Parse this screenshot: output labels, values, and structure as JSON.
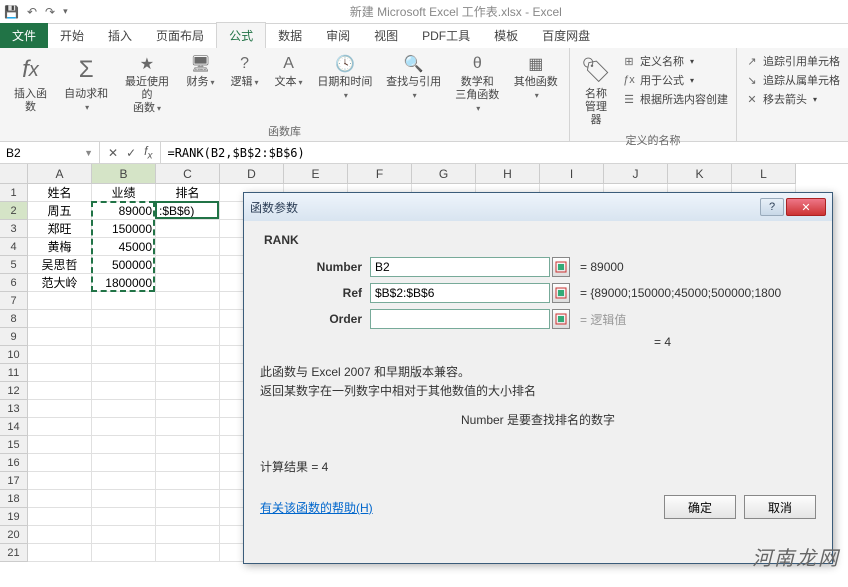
{
  "app": {
    "title": "新建 Microsoft Excel 工作表.xlsx - Excel"
  },
  "tabs": {
    "file": "文件",
    "home": "开始",
    "insert": "插入",
    "layout": "页面布局",
    "formula": "公式",
    "data": "数据",
    "review": "审阅",
    "view": "视图",
    "pdf": "PDF工具",
    "tpl": "模板",
    "baidu": "百度网盘"
  },
  "ribbon": {
    "insertfn": "插入函数",
    "autosum": "自动求和",
    "recent": "最近使用的\n函数",
    "financial": "财务",
    "logical": "逻辑",
    "text": "文本",
    "datetime": "日期和时间",
    "lookup": "查找与引用",
    "math": "数学和\n三角函数",
    "more": "其他函数",
    "fnlib": "函数库",
    "namemgr": "名称\n管理器",
    "defname": "定义名称",
    "usefml": "用于公式",
    "fromsel": "根据所选内容创建",
    "defgroup": "定义的名称",
    "traceprec": "追踪引用单元格",
    "tracedep": "追踪从属单元格",
    "removearrows": "移去箭头"
  },
  "fbar": {
    "name": "B2",
    "formula": "=RANK(B2,$B$2:$B$6)"
  },
  "cols": [
    "A",
    "B",
    "C",
    "D",
    "E",
    "F",
    "G",
    "H",
    "I",
    "J",
    "K",
    "L"
  ],
  "sheet": {
    "h": {
      "a": "姓名",
      "b": "业绩",
      "c": "排名"
    },
    "rows": [
      {
        "a": "周五",
        "b": "89000",
        "c": ":$B$6)"
      },
      {
        "a": "郑旺",
        "b": "150000"
      },
      {
        "a": "黄梅",
        "b": "45000"
      },
      {
        "a": "吴思哲",
        "b": "500000"
      },
      {
        "a": "范大岭",
        "b": "1800000"
      }
    ]
  },
  "dialog": {
    "title": "函数参数",
    "func": "RANK",
    "args": {
      "number_l": "Number",
      "number_v": "B2",
      "number_r": "= 89000",
      "ref_l": "Ref",
      "ref_v": "$B$2:$B$6",
      "ref_r": "= {89000;150000;45000;500000;1800",
      "order_l": "Order",
      "order_v": "",
      "order_r": "= 逻辑值"
    },
    "eqres": "= 4",
    "desc1": "此函数与 Excel 2007 和早期版本兼容。",
    "desc2": "返回某数字在一列数字中相对于其他数值的大小排名",
    "paramdesc": "Number  是要查找排名的数字",
    "calc": "计算结果 = 4",
    "help": "有关该函数的帮助(H)",
    "ok": "确定",
    "cancel": "取消"
  },
  "watermark": "河南龙网"
}
